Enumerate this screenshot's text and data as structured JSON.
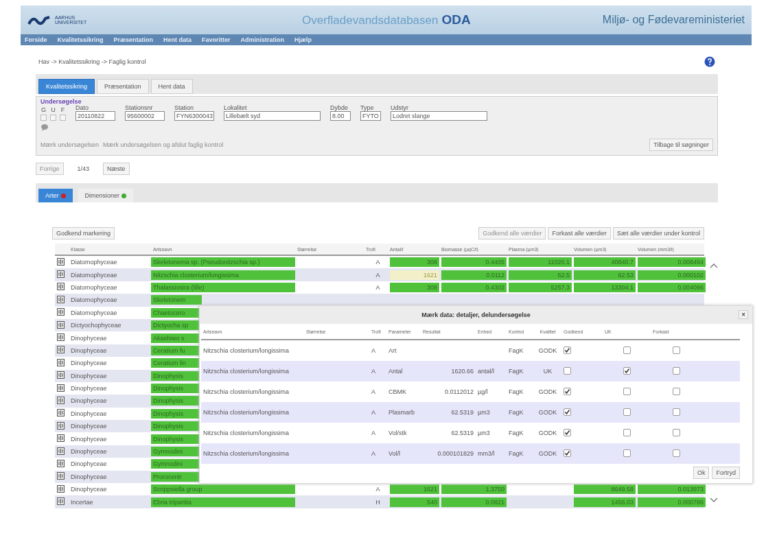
{
  "header": {
    "logo_name": "AARHUS",
    "logo_name2": "UNIVERSITET",
    "title": "Overfladevandsdatabasen",
    "title_brand": "ODA",
    "ministry": "Miljø- og Fødevareministeriet"
  },
  "nav": [
    "Forside",
    "Kvalitetssikring",
    "Præsentation",
    "Hent data",
    "Favoritter",
    "Administration",
    "Hjælp"
  ],
  "breadcrumb": "Hav -> Kvalitetssikring -> Faglig kontrol",
  "tabs": [
    {
      "label": "Kvalitetssikring",
      "selected": true
    },
    {
      "label": "Præsentation",
      "selected": false
    },
    {
      "label": "Hent data",
      "selected": false
    }
  ],
  "survey": {
    "legend": "Undersøgelse",
    "flags": [
      {
        "label": "G",
        "checked": false
      },
      {
        "label": "U",
        "checked": false
      },
      {
        "label": "F",
        "checked": false
      }
    ],
    "fields": [
      {
        "label": "Dato",
        "value": "20110822"
      },
      {
        "label": "Stationsnr",
        "value": "95600002"
      },
      {
        "label": "Station",
        "value": "FYN6300043"
      },
      {
        "label": "Lokalitet",
        "value": "Lillebælt syd"
      },
      {
        "label": "Dybde",
        "value": "8.00"
      },
      {
        "label": "Type",
        "value": "FYTO"
      },
      {
        "label": "Udstyr",
        "value": "Lodret slange"
      }
    ],
    "links": [
      "Mærk undersøgelsen",
      "Mærk undersøgelsen og afslut faglig kontrol"
    ],
    "back_button": "Tilbage til søgninger"
  },
  "pager": {
    "prev": "Forrige",
    "position": "1/43",
    "next": "Næste"
  },
  "subtabs": [
    {
      "label": "Arter",
      "selected": true,
      "color": "#cc2222"
    },
    {
      "label": "Dimensioner",
      "selected": false,
      "color": "#44aa33"
    }
  ],
  "actions": {
    "left": "Godkend markering",
    "right": [
      {
        "label": "Godkend alle værdier",
        "disabled": true
      },
      {
        "label": "Forkast alle værdier",
        "disabled": false
      },
      {
        "label": "Sæt alle værdier under kontrol",
        "disabled": false
      }
    ]
  },
  "table": {
    "columns": [
      "Klasse",
      "Artsnavn",
      "Størrelse",
      "Trofi",
      "Antal/l",
      "Biomasse (µgC/l)",
      "Plasma (µm3)",
      "Volumen (µm3)",
      "Volumen (mm3/l)"
    ],
    "rows": [
      {
        "klasse": "Diatomophyceae",
        "artsnavn": "Skeletonema sp. (Pseudonitzschia sp.)",
        "trofi": "A",
        "antal": "308",
        "biomasse": "0.4405",
        "plasma": "11020.1",
        "volumen": "40840.7",
        "volumen_l": "0.008494",
        "highlight": false
      },
      {
        "klasse": "Diatomophyceae",
        "artsnavn": "Nitzschia closterium/longissima",
        "trofi": "A",
        "antal": "1621",
        "biomasse": "0.0112",
        "plasma": "62.5",
        "volumen": "62.53",
        "volumen_l": "0.000102",
        "highlight": true
      },
      {
        "klasse": "Diatomophyceae",
        "artsnavn": "Thalassiosira (lille)",
        "trofi": "A",
        "antal": "308",
        "biomasse": "0.4302",
        "plasma": "5257.3",
        "volumen": "13304.1",
        "volumen_l": "0.004096",
        "highlight": false
      },
      {
        "klasse": "Diatomophyceae",
        "artsnavn": "Skeletonem"
      },
      {
        "klasse": "Diatomophyceae",
        "artsnavn": "Chaetocero"
      },
      {
        "klasse": "Dictyochophyceae",
        "artsnavn": "Dictyocha sp"
      },
      {
        "klasse": "Dinophyceae",
        "artsnavn": "Akashiwo s"
      },
      {
        "klasse": "Dinophyceae",
        "artsnavn": "Ceratium fu"
      },
      {
        "klasse": "Dinophyceae",
        "artsnavn": "Ceratium lin"
      },
      {
        "klasse": "Dinophyceae",
        "artsnavn": "Dinophysis"
      },
      {
        "klasse": "Dinophyceae",
        "artsnavn": "Dinophysis"
      },
      {
        "klasse": "Dinophyceae",
        "artsnavn": "Dinophysis"
      },
      {
        "klasse": "Dinophyceae",
        "artsnavn": "Dinophysis"
      },
      {
        "klasse": "Dinophyceae",
        "artsnavn": "Dinophysis"
      },
      {
        "klasse": "Dinophyceae",
        "artsnavn": "Dinophysis"
      },
      {
        "klasse": "Dinophyceae",
        "artsnavn": "Gymnodini"
      },
      {
        "klasse": "Dinophyceae",
        "artsnavn": "Gymnodini"
      },
      {
        "klasse": "Dinophyceae",
        "artsnavn": "Prorocentr"
      },
      {
        "klasse": "Dinophyceae",
        "artsnavn": "Scrippsiella group",
        "trofi": "A",
        "antal": "1621",
        "biomasse": "1.3750",
        "volumen": "8649.58",
        "volumen_l": "0.013973",
        "highlight": false
      },
      {
        "klasse": "Incertae",
        "artsnavn": "Ebria tripartita",
        "trofi": "H",
        "antal": "540",
        "biomasse": "0.0821",
        "volumen": "1456.03",
        "volumen_l": "0.000786",
        "highlight": false
      }
    ]
  },
  "dialog": {
    "title": "Mærk data: detaljer, delundersøgelse",
    "close": "×",
    "columns": [
      "Artsnavn",
      "Størrelse",
      "Trofi",
      "Parameter",
      "Resultat",
      "Enhed",
      "Kontrol",
      "Kvalitet",
      "Godkend",
      "UK",
      "Forkast"
    ],
    "rows": [
      {
        "artsnavn": "Nitzschia closterium/longissima",
        "trofi": "A",
        "parameter": "Art",
        "kontrol": "FagK",
        "kvalitet": "GODK",
        "godkend": true,
        "uk": false,
        "forkast": false
      },
      {
        "artsnavn": "Nitzschia closterium/longissima",
        "trofi": "A",
        "parameter": "Antal",
        "resultat": "1620.66",
        "enhed": "antal/l",
        "kontrol": "FagK",
        "kvalitet": "UK",
        "godkend": false,
        "uk": true,
        "forkast": false
      },
      {
        "artsnavn": "Nitzschia closterium/longissima",
        "trofi": "A",
        "parameter": "CBMK",
        "resultat": "0.0112012",
        "enhed": "µg/l",
        "kontrol": "FagK",
        "kvalitet": "GODK",
        "godkend": true,
        "uk": false,
        "forkast": false
      },
      {
        "artsnavn": "Nitzschia closterium/longissima",
        "trofi": "A",
        "parameter": "Plasmarb",
        "resultat": "62.5319",
        "enhed": "µm3",
        "kontrol": "FagK",
        "kvalitet": "GODK",
        "godkend": true,
        "uk": false,
        "forkast": false
      },
      {
        "artsnavn": "Nitzschia closterium/longissima",
        "trofi": "A",
        "parameter": "Vol/stk",
        "resultat": "62.5319",
        "enhed": "µm3",
        "kontrol": "FagK",
        "kvalitet": "GODK",
        "godkend": true,
        "uk": false,
        "forkast": false
      },
      {
        "artsnavn": "Nitzschia closterium/longissima",
        "trofi": "A",
        "parameter": "Vol/l",
        "resultat": "0.000101829",
        "enhed": "mm3/l",
        "kontrol": "FagK",
        "kvalitet": "GODK",
        "godkend": true,
        "uk": false,
        "forkast": false
      }
    ],
    "buttons": [
      "Ok",
      "Fortryd"
    ]
  }
}
